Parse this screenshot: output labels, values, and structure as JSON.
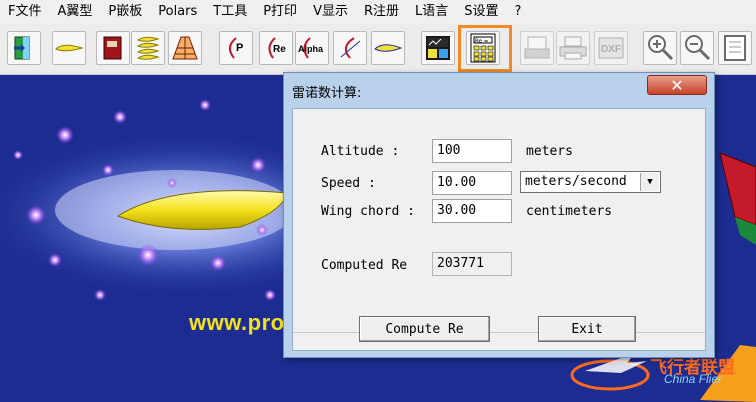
{
  "menu": [
    "F文件",
    "A翼型",
    "P嵌板",
    "Polars",
    "T工具",
    "P打印",
    "V显示",
    "R注册",
    "L语言",
    "S设置",
    "?"
  ],
  "toolbar": {
    "buttons": [
      {
        "name": "exit-icon"
      },
      {
        "name": "airfoil-icon"
      },
      {
        "name": "book-icon"
      },
      {
        "name": "stack-airfoils-icon"
      },
      {
        "name": "wing-panel-icon"
      },
      {
        "name": "polar-p-icon",
        "label": "P"
      },
      {
        "name": "polar-re-icon",
        "label": "Re"
      },
      {
        "name": "polar-alpha-icon",
        "label": "Alpha"
      },
      {
        "name": "polar-curve-icon"
      },
      {
        "name": "airfoil-profile-icon"
      },
      {
        "name": "chart-report-icon"
      },
      {
        "name": "calculator-icon",
        "label": "Re ="
      },
      {
        "name": "plotter-icon"
      },
      {
        "name": "printer-icon"
      },
      {
        "name": "dxf-icon",
        "label": "DXF"
      },
      {
        "name": "zoom-in-icon"
      },
      {
        "name": "zoom-out-icon"
      },
      {
        "name": "page-icon"
      }
    ],
    "highlight_color": "#f08a24"
  },
  "background": {
    "website_text": "www.pro",
    "watermark_text": "飞行者联盟",
    "watermark_sub": "China Flier"
  },
  "dialog": {
    "title": "雷诺数计算:",
    "close_glyph": "✕",
    "altitude_label": "Altitude :",
    "altitude_value": "100",
    "altitude_unit": "meters",
    "speed_label": "Speed :",
    "speed_value": "10.00",
    "speed_unit": "meters/second",
    "chord_label": "Wing chord :",
    "chord_value": "30.00",
    "chord_unit": "centimeters",
    "result_label": "Computed Re",
    "result_value": "203771",
    "compute_button": "Compute Re",
    "exit_button": "Exit"
  }
}
